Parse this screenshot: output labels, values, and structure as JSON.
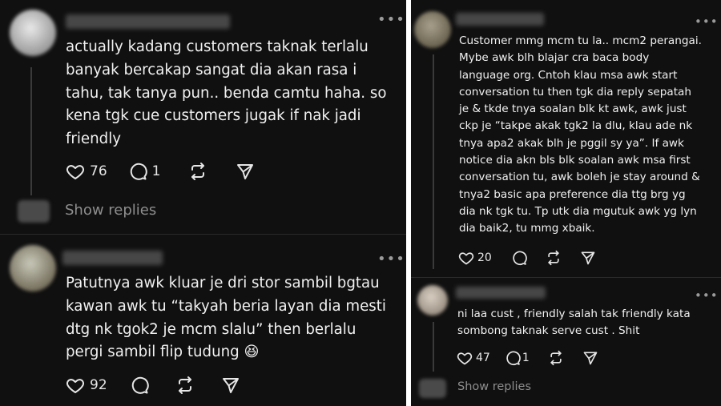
{
  "left": {
    "post1": {
      "text": "actually kadang customers taknak terlalu\nbanyak bercakap sangat dia akan rasa i\ntahu, tak tanya pun.. benda camtu haha. so\nkena tgk cue customers jugak if nak jadi\nfriendly",
      "likes": "76",
      "comments": "1",
      "show_replies": "Show replies"
    },
    "post2": {
      "text": "Patutnya awk kluar je dri stor sambil bgtau\nkawan awk tu “takyah beria layan dia mesti\ndtg nk tgok2 je mcm slalu” then berlalu\npergi sambil flip tudung 😆",
      "likes": "92"
    }
  },
  "right": {
    "post1": {
      "text": "Customer mmg mcm tu la.. mcm2 perangai.\nMybe awk blh blajar cra baca body\nlanguage org. Cntoh klau msa awk start\nconversation tu then tgk dia reply sepatah\nje & tkde tnya soalan blk kt awk, awk just\nckp je “takpe akak tgk2 la dlu, klau ade nk\ntnya apa2 akak blh je pggil sy ya”. If awk\nnotice dia akn bls blk soalan awk msa first\nconversation tu, awk boleh je stay around &\ntnya2 basic apa preference dia ttg brg yg\ndia nk tgk tu. Tp utk dia mgutuk awk yg lyn\ndia baik2, tu mmg xbaik.",
      "likes": "20"
    },
    "post2": {
      "text": "ni laa cust , friendly salah tak friendly kata\nsombong taknak serve cust . Shit",
      "likes": "47",
      "comments": "1",
      "show_replies": "Show replies"
    }
  },
  "icons": {
    "more": "more-icon",
    "like": "heart-icon",
    "comment": "comment-icon",
    "repost": "repost-icon",
    "share": "send-icon"
  }
}
